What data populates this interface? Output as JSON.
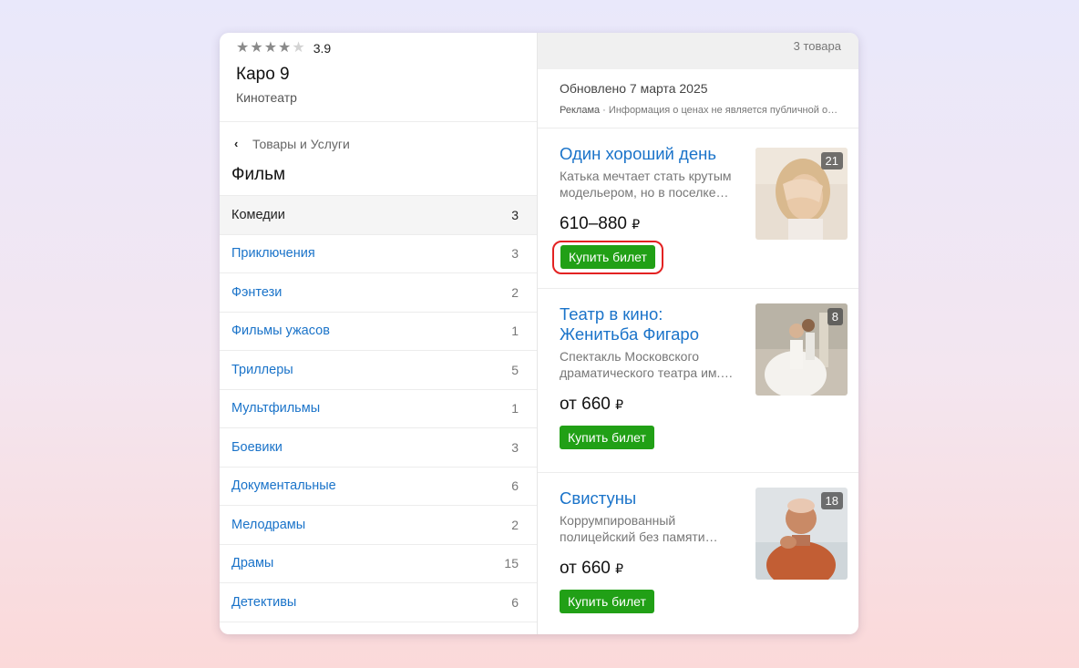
{
  "org": {
    "rating_value": "3.9",
    "name": "Каро 9",
    "type": "Кинотеатр"
  },
  "breadcrumb": {
    "label": "Товары и Услуги"
  },
  "section_title": "Фильм",
  "categories": [
    {
      "label": "Комедии",
      "count": "3"
    },
    {
      "label": "Приключения",
      "count": "3"
    },
    {
      "label": "Фэнтези",
      "count": "2"
    },
    {
      "label": "Фильмы ужасов",
      "count": "1"
    },
    {
      "label": "Триллеры",
      "count": "5"
    },
    {
      "label": "Мультфильмы",
      "count": "1"
    },
    {
      "label": "Боевики",
      "count": "3"
    },
    {
      "label": "Документальные",
      "count": "6"
    },
    {
      "label": "Мелодрамы",
      "count": "2"
    },
    {
      "label": "Драмы",
      "count": "15"
    },
    {
      "label": "Детективы",
      "count": "6"
    }
  ],
  "topbar": {
    "count_label": "3 товара"
  },
  "info": {
    "updated": "Обновлено 7 марта 2025",
    "ad_label": "Реклама",
    "ad_note": "Информация о ценах не является публичной офертой"
  },
  "products": [
    {
      "title": "Один хороший день",
      "desc": "Катька мечтает стать крутым модельером, но в поселке…",
      "price": "610–880",
      "currency": "₽",
      "buy_label": "Купить билет",
      "photo_count": "21"
    },
    {
      "title": "Театр в кино: Женитьба Фигаро",
      "desc": "Спектакль Московского драматического театра им.…",
      "price": "от 660",
      "currency": "₽",
      "buy_label": "Купить билет",
      "photo_count": "8"
    },
    {
      "title": "Свистуны",
      "desc": "Коррумпированный полицейский без памяти…",
      "price": "от 660",
      "currency": "₽",
      "buy_label": "Купить билет",
      "photo_count": "18"
    }
  ],
  "colors": {
    "link": "#1a73c9",
    "buy_button": "#21a016",
    "highlight": "#e32222"
  }
}
